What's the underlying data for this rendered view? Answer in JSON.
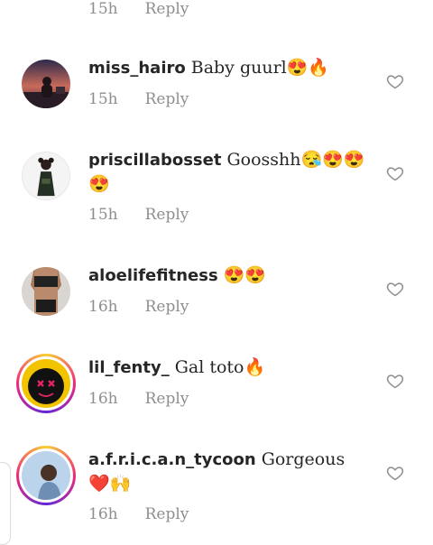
{
  "top_comment": {
    "time": "15h",
    "reply_label": "Reply"
  },
  "comments": [
    {
      "username": "miss_hairo",
      "text": "Baby guurl😍🔥",
      "time": "15h",
      "reply_label": "Reply",
      "has_story_ring": false
    },
    {
      "username": "priscillabosset",
      "text": "Goosshh😪😍😍😍",
      "time": "15h",
      "reply_label": "Reply",
      "has_story_ring": false
    },
    {
      "username": "aloelifefitness",
      "text": "😍😍",
      "time": "16h",
      "reply_label": "Reply",
      "has_story_ring": false
    },
    {
      "username": "lil_fenty_",
      "text": "Gal toto🔥",
      "time": "16h",
      "reply_label": "Reply",
      "has_story_ring": true
    },
    {
      "username": "a.f.r.i.c.a.n_tycoon",
      "text": "Gorgeous ❤️🙌",
      "time": "16h",
      "reply_label": "Reply",
      "has_story_ring": true
    }
  ],
  "colors": {
    "text": "#262626",
    "secondary": "#8e8e8e",
    "story_ring_start": "#f9ce34",
    "story_ring_mid": "#ee2a7b",
    "story_ring_end": "#6228d7"
  },
  "icons": {
    "like": "heart-outline-icon"
  }
}
